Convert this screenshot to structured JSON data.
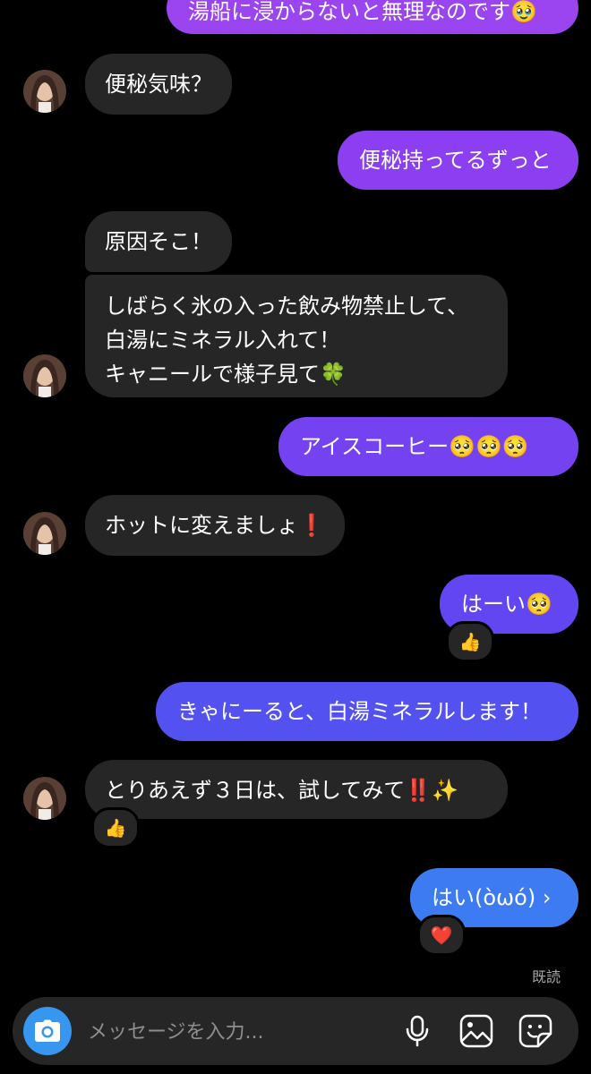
{
  "colors": {
    "background": "#000000",
    "incoming_bubble": "#262626",
    "outgoing_purple": "#8e44f0",
    "outgoing_violet": "#6b4bf2",
    "outgoing_indigo": "#5a55f0",
    "outgoing_blue": "#3d7bf3",
    "composer": "#262626",
    "camera_button": "#3797f0",
    "seen_text": "#a8a8a8"
  },
  "messages": [
    {
      "direction": "outgoing",
      "text": "湯船に浸からないと無理なのです🥹"
    },
    {
      "direction": "incoming",
      "text": "便秘気味？"
    },
    {
      "direction": "outgoing",
      "text": "便秘持ってるずっと"
    },
    {
      "direction": "incoming",
      "text": "原因そこ！"
    },
    {
      "direction": "incoming",
      "lines": [
        "しばらく氷の入った飲み物禁止して、",
        "白湯にミネラル入れて！",
        "キャニールで様子見て🍀"
      ]
    },
    {
      "direction": "outgoing",
      "text": "アイスコーヒー🥺🥺🥺"
    },
    {
      "direction": "incoming",
      "text": "ホットに変えましょ❗️"
    },
    {
      "direction": "outgoing",
      "text": "はーい🥺",
      "reaction": "👍"
    },
    {
      "direction": "outgoing",
      "text": "きゃにーると、白湯ミネラルします！"
    },
    {
      "direction": "incoming",
      "text": "とりあえず３日は、試してみて‼️✨",
      "reaction": "👍"
    },
    {
      "direction": "outgoing",
      "text": "はい(òωó) ›",
      "reaction": "❤️"
    }
  ],
  "seen_label": "既読",
  "composer": {
    "placeholder": "メッセージを入力...",
    "camera_icon": "camera-icon",
    "mic_icon": "microphone-icon",
    "gallery_icon": "image-icon",
    "sticker_icon": "sticker-icon"
  }
}
